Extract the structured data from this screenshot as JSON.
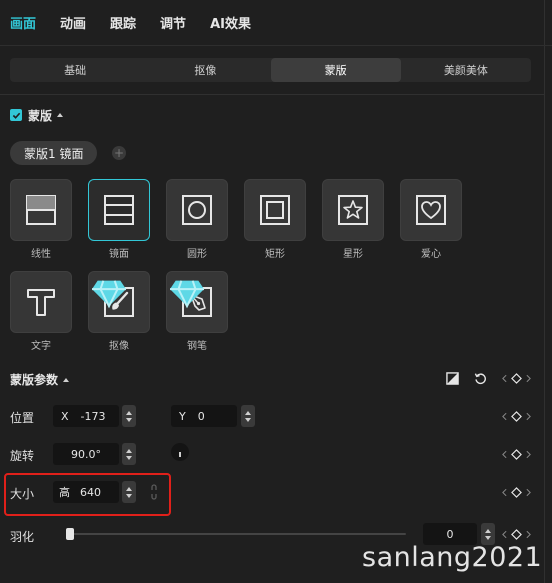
{
  "top_tabs": [
    {
      "label": "画面",
      "active": true
    },
    {
      "label": "动画",
      "active": false
    },
    {
      "label": "跟踪",
      "active": false
    },
    {
      "label": "调节",
      "active": false
    },
    {
      "label": "AI效果",
      "active": false
    }
  ],
  "sub_tabs": [
    {
      "label": "基础",
      "active": false
    },
    {
      "label": "抠像",
      "active": false
    },
    {
      "label": "蒙版",
      "active": true
    },
    {
      "label": "美颜美体",
      "active": false
    }
  ],
  "mask_section": {
    "title": "蒙版",
    "enabled": true,
    "chip_label": "蒙版1 镜面",
    "add_symbol": "+"
  },
  "shapes": [
    {
      "label": "线性",
      "icon": "linear-mask-icon",
      "selected": false,
      "vip": false
    },
    {
      "label": "镜面",
      "icon": "mirror-mask-icon",
      "selected": true,
      "vip": false
    },
    {
      "label": "圆形",
      "icon": "circle-mask-icon",
      "selected": false,
      "vip": false
    },
    {
      "label": "矩形",
      "icon": "rectangle-mask-icon",
      "selected": false,
      "vip": false
    },
    {
      "label": "星形",
      "icon": "star-mask-icon",
      "selected": false,
      "vip": false
    },
    {
      "label": "爱心",
      "icon": "heart-mask-icon",
      "selected": false,
      "vip": false
    },
    {
      "label": "文字",
      "icon": "text-mask-icon",
      "selected": false,
      "vip": false
    },
    {
      "label": "抠像",
      "icon": "brush-mask-icon",
      "selected": false,
      "vip": true
    },
    {
      "label": "钢笔",
      "icon": "pen-mask-icon",
      "selected": false,
      "vip": true
    }
  ],
  "params": {
    "title": "蒙版参数",
    "position": {
      "label": "位置",
      "x_prefix": "X",
      "x_value": "-173",
      "y_prefix": "Y",
      "y_value": "0"
    },
    "rotation": {
      "label": "旋转",
      "value": "90.0°"
    },
    "size": {
      "label": "大小",
      "prefix": "高",
      "value": "640"
    },
    "feather": {
      "label": "羽化",
      "value": "0",
      "level": 0
    }
  },
  "colors": {
    "accent": "#32c7d6",
    "background": "#1f1f1f",
    "highlight_border": "#e0201a"
  },
  "watermark": "sanlang2021"
}
